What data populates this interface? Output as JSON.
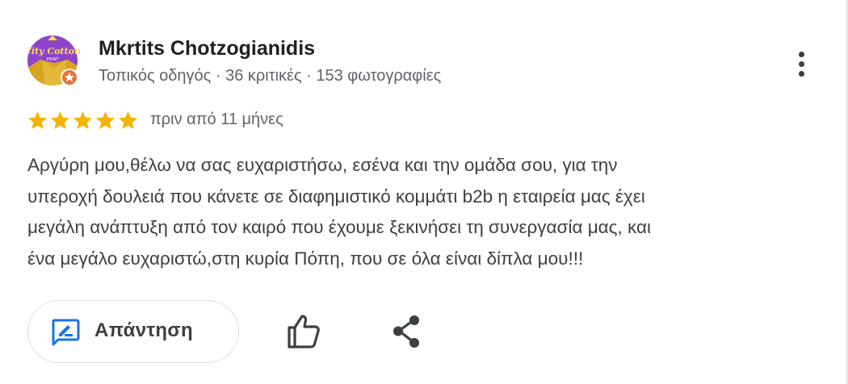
{
  "review": {
    "author": "Mkrtits Chotzogianidis",
    "meta": "Τοπικός οδηγός · 36 κριτικές · 153 φωτογραφίες",
    "avatar_text_top": "City Cotton",
    "avatar_text_bottom": "PRINT",
    "rating": 5,
    "max_rating": 5,
    "time_ago": "πριν από 11 μήνες",
    "text_lines": [
      "Αργύρη μου,θέλω να σας ευχαριστήσω, εσένα και την ομάδα σου, για την",
      "υπεροχή δουλειά που κάνετε σε διαφημιστικό κομμάτι b2b η εταιρεία μας έχει",
      "μεγάλη ανάπτυξη από τον καιρό που έχουμε ξεκινήσει τη συνεργασία μας, και",
      "ένα μεγάλο ευχαριστώ,στη κυρία Πόπη, που σε όλα είναι δίπλα μου!!!"
    ]
  },
  "actions": {
    "reply_label": "Απάντηση",
    "reply_icon": "rate-review-icon",
    "like_icon": "thumb-up-icon",
    "share_icon": "share-icon",
    "more_icon": "more-vert-icon"
  },
  "colors": {
    "star": "#f4b400",
    "reply_icon": "#1a73e8",
    "avatar_bg": "#8e44c9",
    "avatar_badge": "#e8713c"
  }
}
